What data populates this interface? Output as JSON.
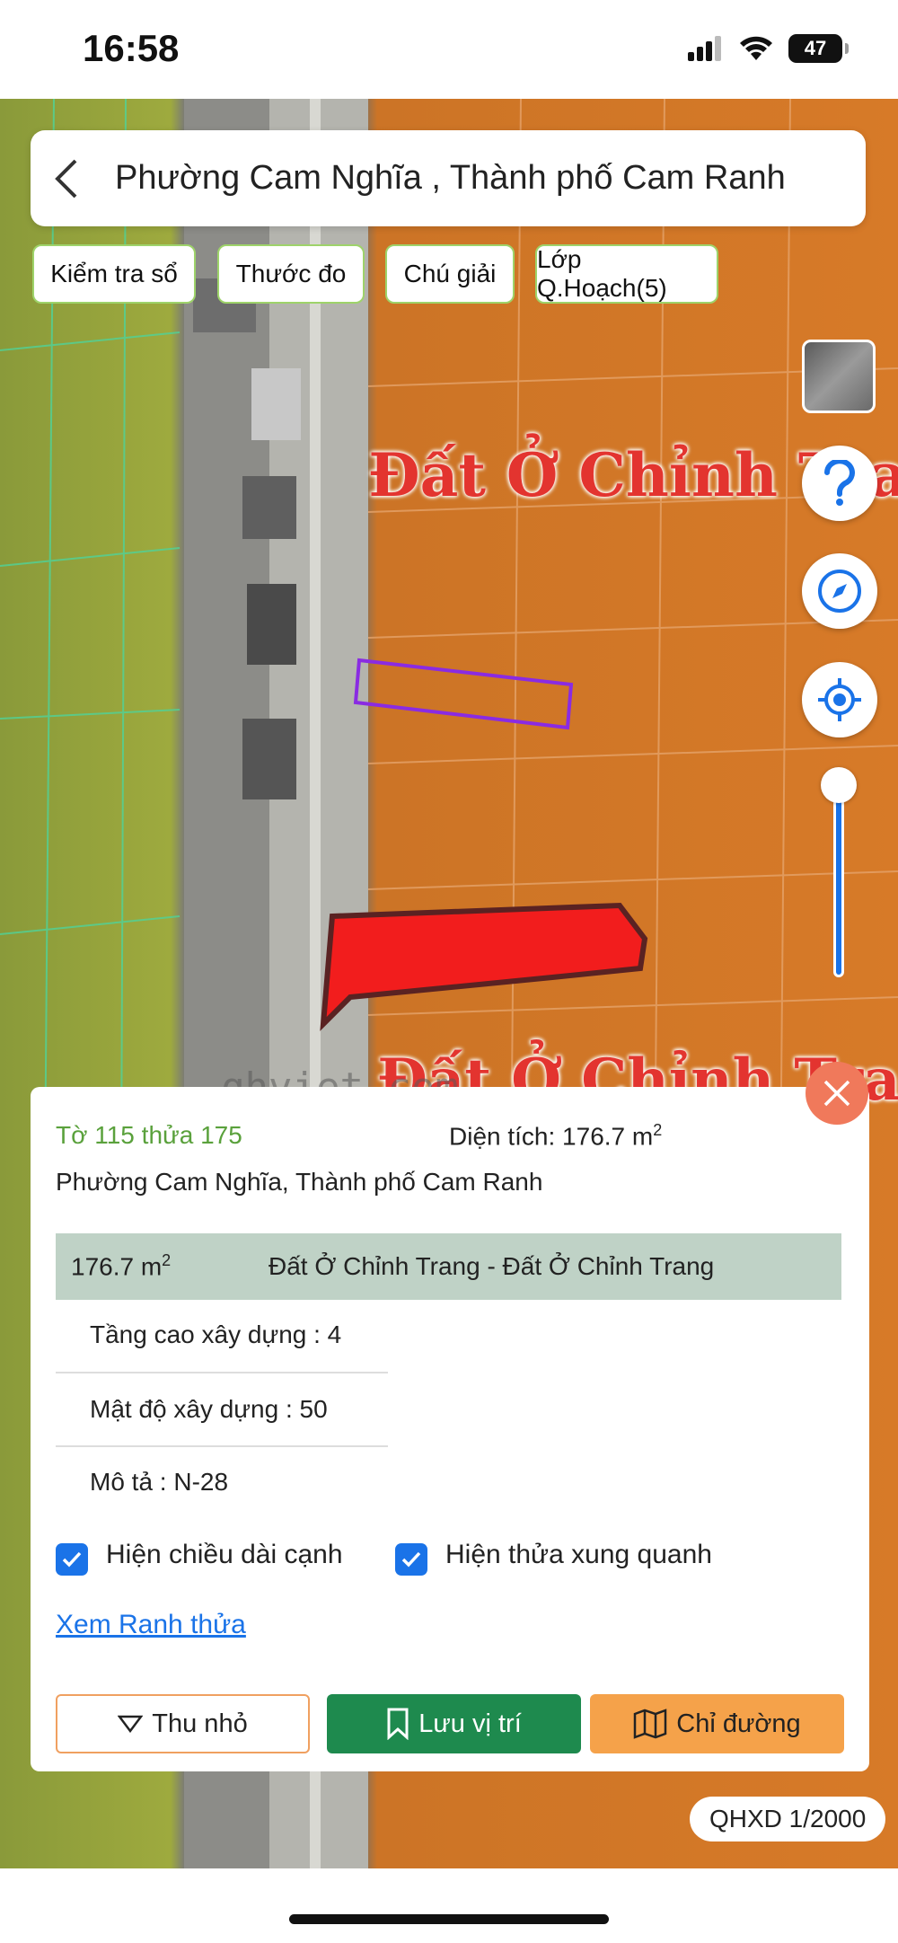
{
  "status_bar": {
    "time": "16:58",
    "battery": "47"
  },
  "header": {
    "title": "Phường Cam Nghĩa , Thành phố Cam Ranh"
  },
  "toolbar": {
    "check_book": "Kiểm tra sổ",
    "ruler": "Thước đo",
    "legend": "Chú giải",
    "planning_layer": "Lớp Q.Hoạch(5)"
  },
  "map": {
    "zone_label_top": "Đất Ở Chỉnh Trang",
    "zone_label_bottom": "Đất Ở Chỉnh Trang",
    "watermark": "qhviet.com",
    "zoom_level": 0.97
  },
  "panel": {
    "parcel_id": "Tờ 115 thửa 175",
    "area_label": "Diện tích: 176.7 m",
    "area_sup": "2",
    "address": "Phường Cam Nghĩa, Thành phố Cam Ranh",
    "zone_area": "176.7 m",
    "zone_area_sup": "2",
    "zone_type": "Đất Ở Chỉnh Trang - Đất Ở Chỉnh Trang",
    "floors": "Tầng cao xây dựng : 4",
    "density": "Mật độ xây dựng : 50",
    "description": "Mô tả : N-28",
    "show_edge_length": "Hiện chiều dài cạnh",
    "show_surrounding": "Hiện thửa xung quanh",
    "view_boundary_link": "Xem Ranh thửa",
    "collapse_button": "Thu nhỏ",
    "save_button": "Lưu vị trí",
    "route_button": "Chỉ đường"
  },
  "scale": "QHXD 1/2000",
  "colors": {
    "accent_blue": "#1a73e8",
    "residential_zone": "#d77a28",
    "highlight_red": "#f21d1d",
    "save_green": "#1e8a4e",
    "route_orange": "#f5a24a"
  }
}
